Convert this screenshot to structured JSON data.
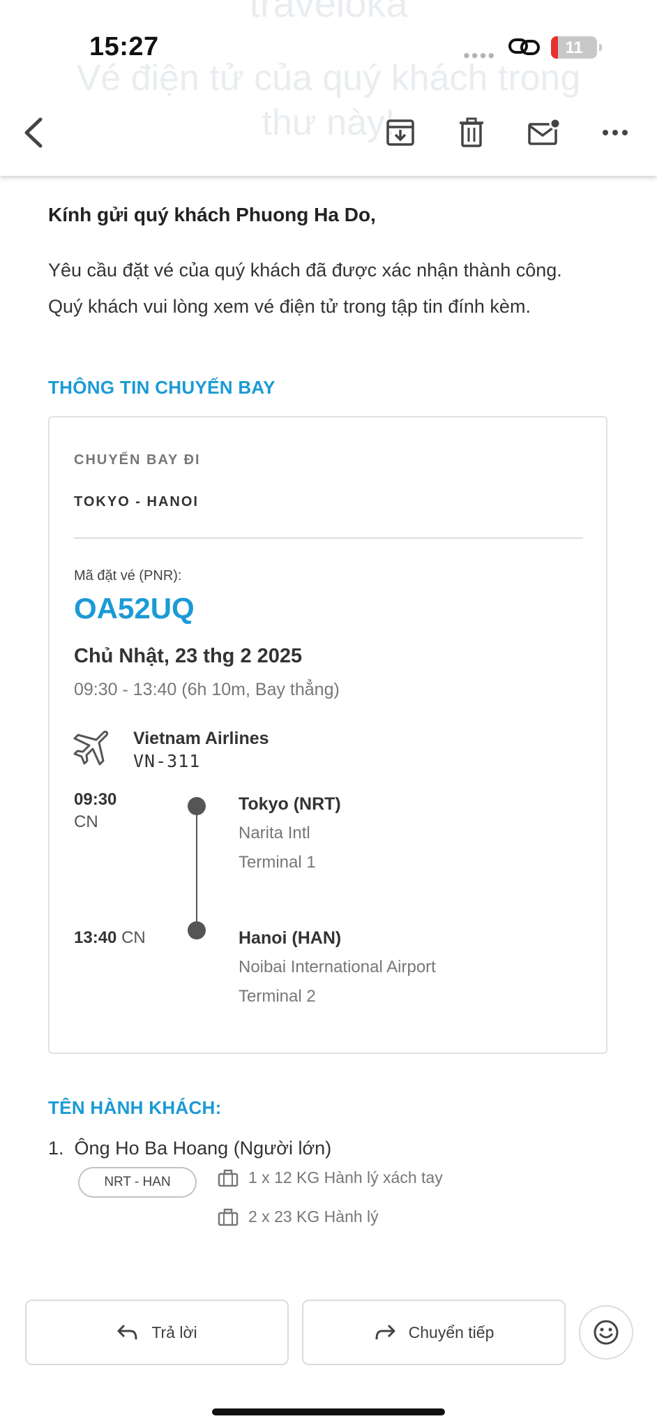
{
  "status_bar": {
    "time": "15:27",
    "battery": "11"
  },
  "header": {
    "ghost_lines": [
      "traveloka",
      "Vé điện tử của quý khách trong",
      "thư này!"
    ],
    "icons": [
      "back-icon",
      "archive-icon",
      "trash-icon",
      "mark-unread-icon",
      "more-icon"
    ]
  },
  "email": {
    "greeting": "Kính gửi quý khách Phuong Ha Do,",
    "message_line1": "Yêu cầu đặt vé của quý khách đã được xác nhận thành công.",
    "message_line2": "Quý khách vui lòng xem vé điện tử trong tập tin đính kèm."
  },
  "flight_info": {
    "section_title": "THÔNG TIN CHUYẾN BAY",
    "direction_label": "CHUYẾN BAY ĐI",
    "route": "TOKYO - HANOI",
    "pnr_label": "Mã đặt vé (PNR):",
    "pnr": "OA52UQ",
    "date": "Chủ Nhật, 23 thg 2 2025",
    "time_summary": "09:30 - 13:40 (6h 10m, Bay thẳng)",
    "airline": "Vietnam Airlines",
    "flight_number": "VN-311",
    "departure": {
      "time": "09:30",
      "day": "CN",
      "city": "Tokyo (NRT)",
      "airport": "Narita Intl",
      "terminal": "Terminal 1"
    },
    "arrival": {
      "time": "13:40",
      "day": "CN",
      "city": "Hanoi (HAN)",
      "airport": "Noibai International Airport",
      "terminal": "Terminal 2"
    }
  },
  "passengers": {
    "section_title": "TÊN HÀNH KHÁCH:",
    "list": [
      {
        "index": "1.",
        "name": "Ông Ho Ba Hoang (Người lớn)",
        "segment": "NRT - HAN",
        "baggage": [
          "1 x 12 KG Hành lý xách tay",
          "2 x 23 KG Hành lý"
        ]
      }
    ]
  },
  "actions": {
    "reply": "Trả lời",
    "forward": "Chuyển tiếp"
  },
  "colors": {
    "accent": "#1b9ad6",
    "battery_low": "#e5312f"
  }
}
